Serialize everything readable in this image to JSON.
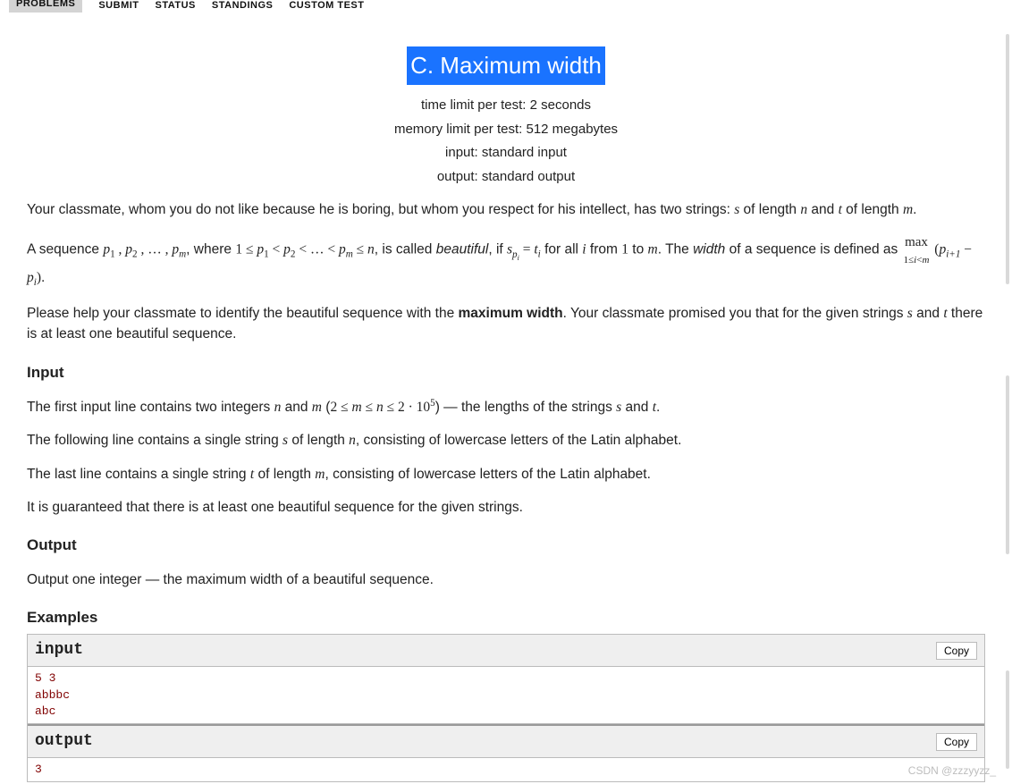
{
  "nav": {
    "items": [
      "PROBLEMS",
      "SUBMIT",
      "STATUS",
      "STANDINGS",
      "CUSTOM TEST"
    ],
    "active_index": 0
  },
  "title": "C. Maximum width",
  "meta": {
    "time": "time limit per test: 2 seconds",
    "memory": "memory limit per test: 512 megabytes",
    "input": "input: standard input",
    "output": "output: standard output"
  },
  "para1_a": "Your classmate, whom you do not like because he is boring, but whom you respect for his intellect, has two strings: ",
  "para1_b": " of length ",
  "para1_c": " and ",
  "para1_d": " of length ",
  "para1_e": ".",
  "para2_a": "A sequence ",
  "para2_b": ", where ",
  "para2_c": ", is called ",
  "para2_beautiful": "beautiful",
  "para2_d": ", if ",
  "para2_e": " for all ",
  "para2_f": " from ",
  "para2_g": " to ",
  "para2_h": ". The ",
  "para2_width": "width",
  "para2_i": " of a sequence is defined as ",
  "para2_j": ".",
  "para3_a": "Please help your classmate to identify the beautiful sequence with the ",
  "para3_bold": "maximum width",
  "para3_b": ". Your classmate promised you that for the given strings ",
  "para3_c": " and ",
  "para3_d": " there is at least one beautiful sequence.",
  "input_h": "Input",
  "input_p1_a": "The first input line contains two integers ",
  "input_p1_b": " and ",
  "input_p1_c": " (",
  "input_p1_d": ") — the lengths of the strings ",
  "input_p1_e": " and ",
  "input_p1_f": ".",
  "input_p2_a": "The following line contains a single string ",
  "input_p2_b": " of length ",
  "input_p2_c": ", consisting of lowercase letters of the Latin alphabet.",
  "input_p3_a": "The last line contains a single string ",
  "input_p3_b": " of length ",
  "input_p3_c": ", consisting of lowercase letters of the Latin alphabet.",
  "input_p4": "It is guaranteed that there is at least one beautiful sequence for the given strings.",
  "output_h": "Output",
  "output_p": "Output one integer — the maximum width of a beautiful sequence.",
  "examples_h": "Examples",
  "ex": {
    "input_label": "input",
    "output_label": "output",
    "copy": "Copy",
    "input_data": "5 3\nabbbc\nabc",
    "output_data": "3"
  },
  "watermark": "CSDN @zzzyyzz_"
}
